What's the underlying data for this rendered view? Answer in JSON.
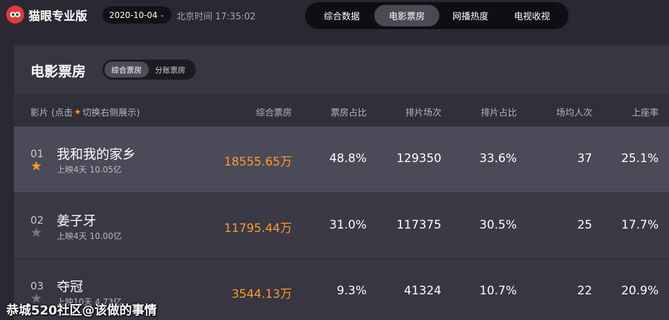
{
  "header": {
    "brand": "猫眼专业版",
    "date": "2020-10-04",
    "clock": "北京时间 17:35:02",
    "nav": [
      "综合数据",
      "电影票房",
      "网播热度",
      "电视收视"
    ],
    "nav_active": "电影票房"
  },
  "panel": {
    "title": "电影票房",
    "segments": [
      "综合票房",
      "分账票房"
    ],
    "segment_active": "综合票房"
  },
  "table": {
    "columns": {
      "movie_prefix": "影片 (点击",
      "movie_suffix": "切换右侧展示)",
      "box": "综合票房",
      "box_share": "票房占比",
      "shows": "排片场次",
      "show_share": "排片占比",
      "avg": "场均人次",
      "occupancy": "上座率"
    },
    "rows": [
      {
        "rank": "01",
        "starred": true,
        "name": "我和我的家乡",
        "sub": "上映4天  10.05亿",
        "box": "18555.65万",
        "box_share": "48.8%",
        "shows": "129350",
        "show_share": "33.6%",
        "avg": "37",
        "occupancy": "25.1%"
      },
      {
        "rank": "02",
        "starred": false,
        "name": "姜子牙",
        "sub": "上映4天  10.00亿",
        "box": "11795.44万",
        "box_share": "31.0%",
        "shows": "117375",
        "show_share": "30.5%",
        "avg": "25",
        "occupancy": "17.7%"
      },
      {
        "rank": "03",
        "starred": false,
        "name": "夺冠",
        "sub": "上映10天  4.73亿",
        "box": "3544.13万",
        "box_share": "9.3%",
        "shows": "41324",
        "show_share": "10.7%",
        "avg": "22",
        "occupancy": "20.9%"
      }
    ]
  },
  "watermark": "恭城520社区@该做的事情",
  "colors": {
    "accent": "#ff9a2e",
    "brand_red": "#e23a3a",
    "background": "#2a2933"
  },
  "icons": {
    "logo": "cat-eye-logo-icon",
    "star": "star-icon",
    "dropdown": "chevron-down-icon"
  }
}
